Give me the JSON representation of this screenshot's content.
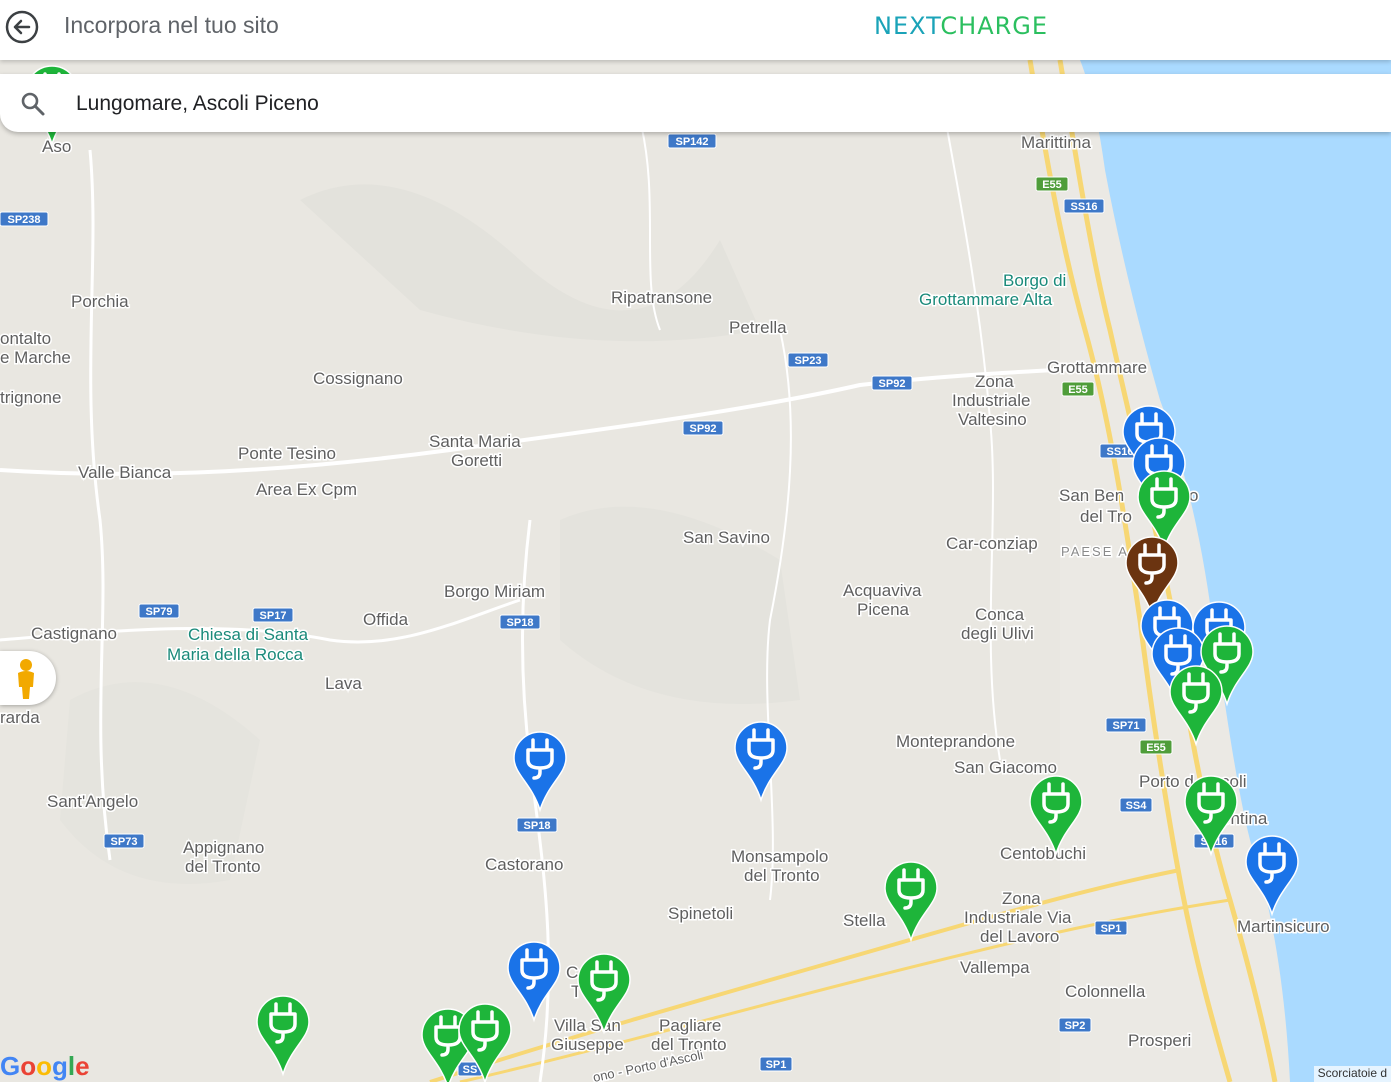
{
  "header": {
    "title": "Incorpora nel tuo sito",
    "logo_part1": "NEXT",
    "logo_part2": "CHARGE"
  },
  "search": {
    "value": "Lungomare, Ascoli Piceno"
  },
  "colors": {
    "blue_pin": "#1a73e8",
    "green_pin": "#1eb53a",
    "brown_pin": "#6b3410",
    "sea": "#aadaff"
  },
  "places": [
    {
      "name": "Aso"
    },
    {
      "name": "Marittima"
    },
    {
      "name": "Porchia"
    },
    {
      "name": "Ripatransone"
    },
    {
      "name": "Borgo di"
    },
    {
      "name": "Grottammare Alta"
    },
    {
      "name": "Petrella"
    },
    {
      "name": "ontalto"
    },
    {
      "name": "e Marche"
    },
    {
      "name": "Cossignano"
    },
    {
      "name": "Grottammare"
    },
    {
      "name": "Zona"
    },
    {
      "name": "Industriale"
    },
    {
      "name": "Valtesino"
    },
    {
      "name": "trignone"
    },
    {
      "name": "Santa Maria"
    },
    {
      "name": "Goretti"
    },
    {
      "name": "Ponte Tesino"
    },
    {
      "name": "Valle Bianca"
    },
    {
      "name": "Area Ex Cpm"
    },
    {
      "name": "San Ben"
    },
    {
      "name": "o"
    },
    {
      "name": "del Tro"
    },
    {
      "name": "San Savino"
    },
    {
      "name": "Car-conziap"
    },
    {
      "name": "PAESE A"
    },
    {
      "name": "Borgo Miriam"
    },
    {
      "name": "Acquaviva"
    },
    {
      "name": "Picena"
    },
    {
      "name": "Castignano"
    },
    {
      "name": "Chiesa di Santa"
    },
    {
      "name": "Maria della Rocca"
    },
    {
      "name": "Offida"
    },
    {
      "name": "Conca"
    },
    {
      "name": "degli Ulivi"
    },
    {
      "name": "Lava"
    },
    {
      "name": "rarda"
    },
    {
      "name": "Monteprandone"
    },
    {
      "name": "San Giacomo"
    },
    {
      "name": "Sant'Angelo"
    },
    {
      "name": "Porto d"
    },
    {
      "name": "coli"
    },
    {
      "name": "entina"
    },
    {
      "name": "Centobuchi"
    },
    {
      "name": "Appignano"
    },
    {
      "name": "del Tronto"
    },
    {
      "name": "Castorano"
    },
    {
      "name": "Monsampolo"
    },
    {
      "name": "del Tronto"
    },
    {
      "name": "Spinetoli"
    },
    {
      "name": "Stella"
    },
    {
      "name": "Zona"
    },
    {
      "name": "Industriale Via"
    },
    {
      "name": "del Lavoro"
    },
    {
      "name": "Martinsicuro"
    },
    {
      "name": "Vallempa"
    },
    {
      "name": "C"
    },
    {
      "name": "T"
    },
    {
      "name": "Villa San"
    },
    {
      "name": "Giuseppe"
    },
    {
      "name": "Pagliare"
    },
    {
      "name": "del Tronto"
    },
    {
      "name": "Colonnella"
    },
    {
      "name": "Prosperi"
    },
    {
      "name": "ono - Porto d'Ascoli"
    }
  ],
  "roads": [
    {
      "label": "SP238"
    },
    {
      "label": "SP142"
    },
    {
      "label": "E55"
    },
    {
      "label": "SS16"
    },
    {
      "label": "SP23"
    },
    {
      "label": "SP92"
    },
    {
      "label": "SP92"
    },
    {
      "label": "E55"
    },
    {
      "label": "SS16"
    },
    {
      "label": "SP79"
    },
    {
      "label": "SP17"
    },
    {
      "label": "SP18"
    },
    {
      "label": "SP71"
    },
    {
      "label": "E55"
    },
    {
      "label": "SS4"
    },
    {
      "label": "SS16"
    },
    {
      "label": "SP73"
    },
    {
      "label": "SP18"
    },
    {
      "label": "SP1"
    },
    {
      "label": "SP2"
    },
    {
      "label": "SP1"
    },
    {
      "label": "SS"
    }
  ],
  "pins": [
    {
      "type": "green"
    },
    {
      "type": "blue"
    },
    {
      "type": "blue"
    },
    {
      "type": "green"
    },
    {
      "type": "brown"
    },
    {
      "type": "blue"
    },
    {
      "type": "blue"
    },
    {
      "type": "blue"
    },
    {
      "type": "green"
    },
    {
      "type": "green"
    },
    {
      "type": "blue"
    },
    {
      "type": "blue"
    },
    {
      "type": "green"
    },
    {
      "type": "green"
    },
    {
      "type": "blue"
    },
    {
      "type": "green"
    },
    {
      "type": "blue"
    },
    {
      "type": "green"
    },
    {
      "type": "green"
    },
    {
      "type": "green"
    },
    {
      "type": "green"
    }
  ],
  "google_logo": [
    "G",
    "o",
    "o",
    "g",
    "l",
    "e"
  ],
  "attribution": "Scorciatoie d"
}
